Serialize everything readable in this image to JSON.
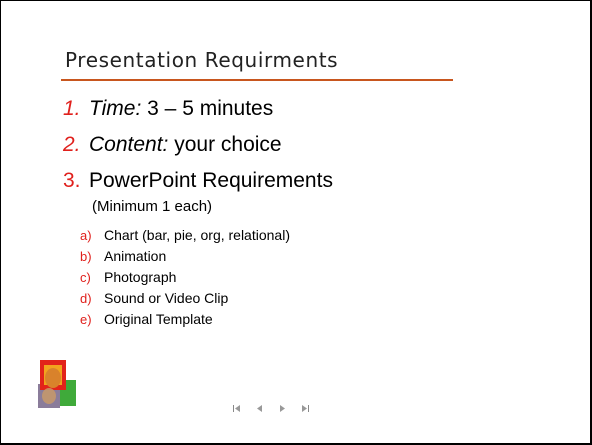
{
  "slide": {
    "title": "Presentation Requirments",
    "items": [
      {
        "number": "1.",
        "label": "Time:",
        "text": " 3 – 5 minutes"
      },
      {
        "number": "2.",
        "label": "Content:",
        "text": " your choice"
      },
      {
        "number": "3.",
        "label": "",
        "text": "PowerPoint Requirements"
      }
    ],
    "note": "(Minimum 1 each)",
    "subitems": [
      {
        "letter": "a)",
        "text": "Chart (bar, pie, org, relational)"
      },
      {
        "letter": "b)",
        "text": "Animation"
      },
      {
        "letter": "c)",
        "text": "Photograph"
      },
      {
        "letter": "d)",
        "text": "Sound or Video Clip"
      },
      {
        "letter": "e)",
        "text": "Original Template"
      }
    ]
  },
  "navigation": {
    "buttons": [
      "first-slide-icon",
      "previous-slide-icon",
      "next-slide-icon",
      "last-slide-icon"
    ]
  },
  "colors": {
    "accent_number": "#e0201c",
    "title_rule": "#c8561e"
  }
}
